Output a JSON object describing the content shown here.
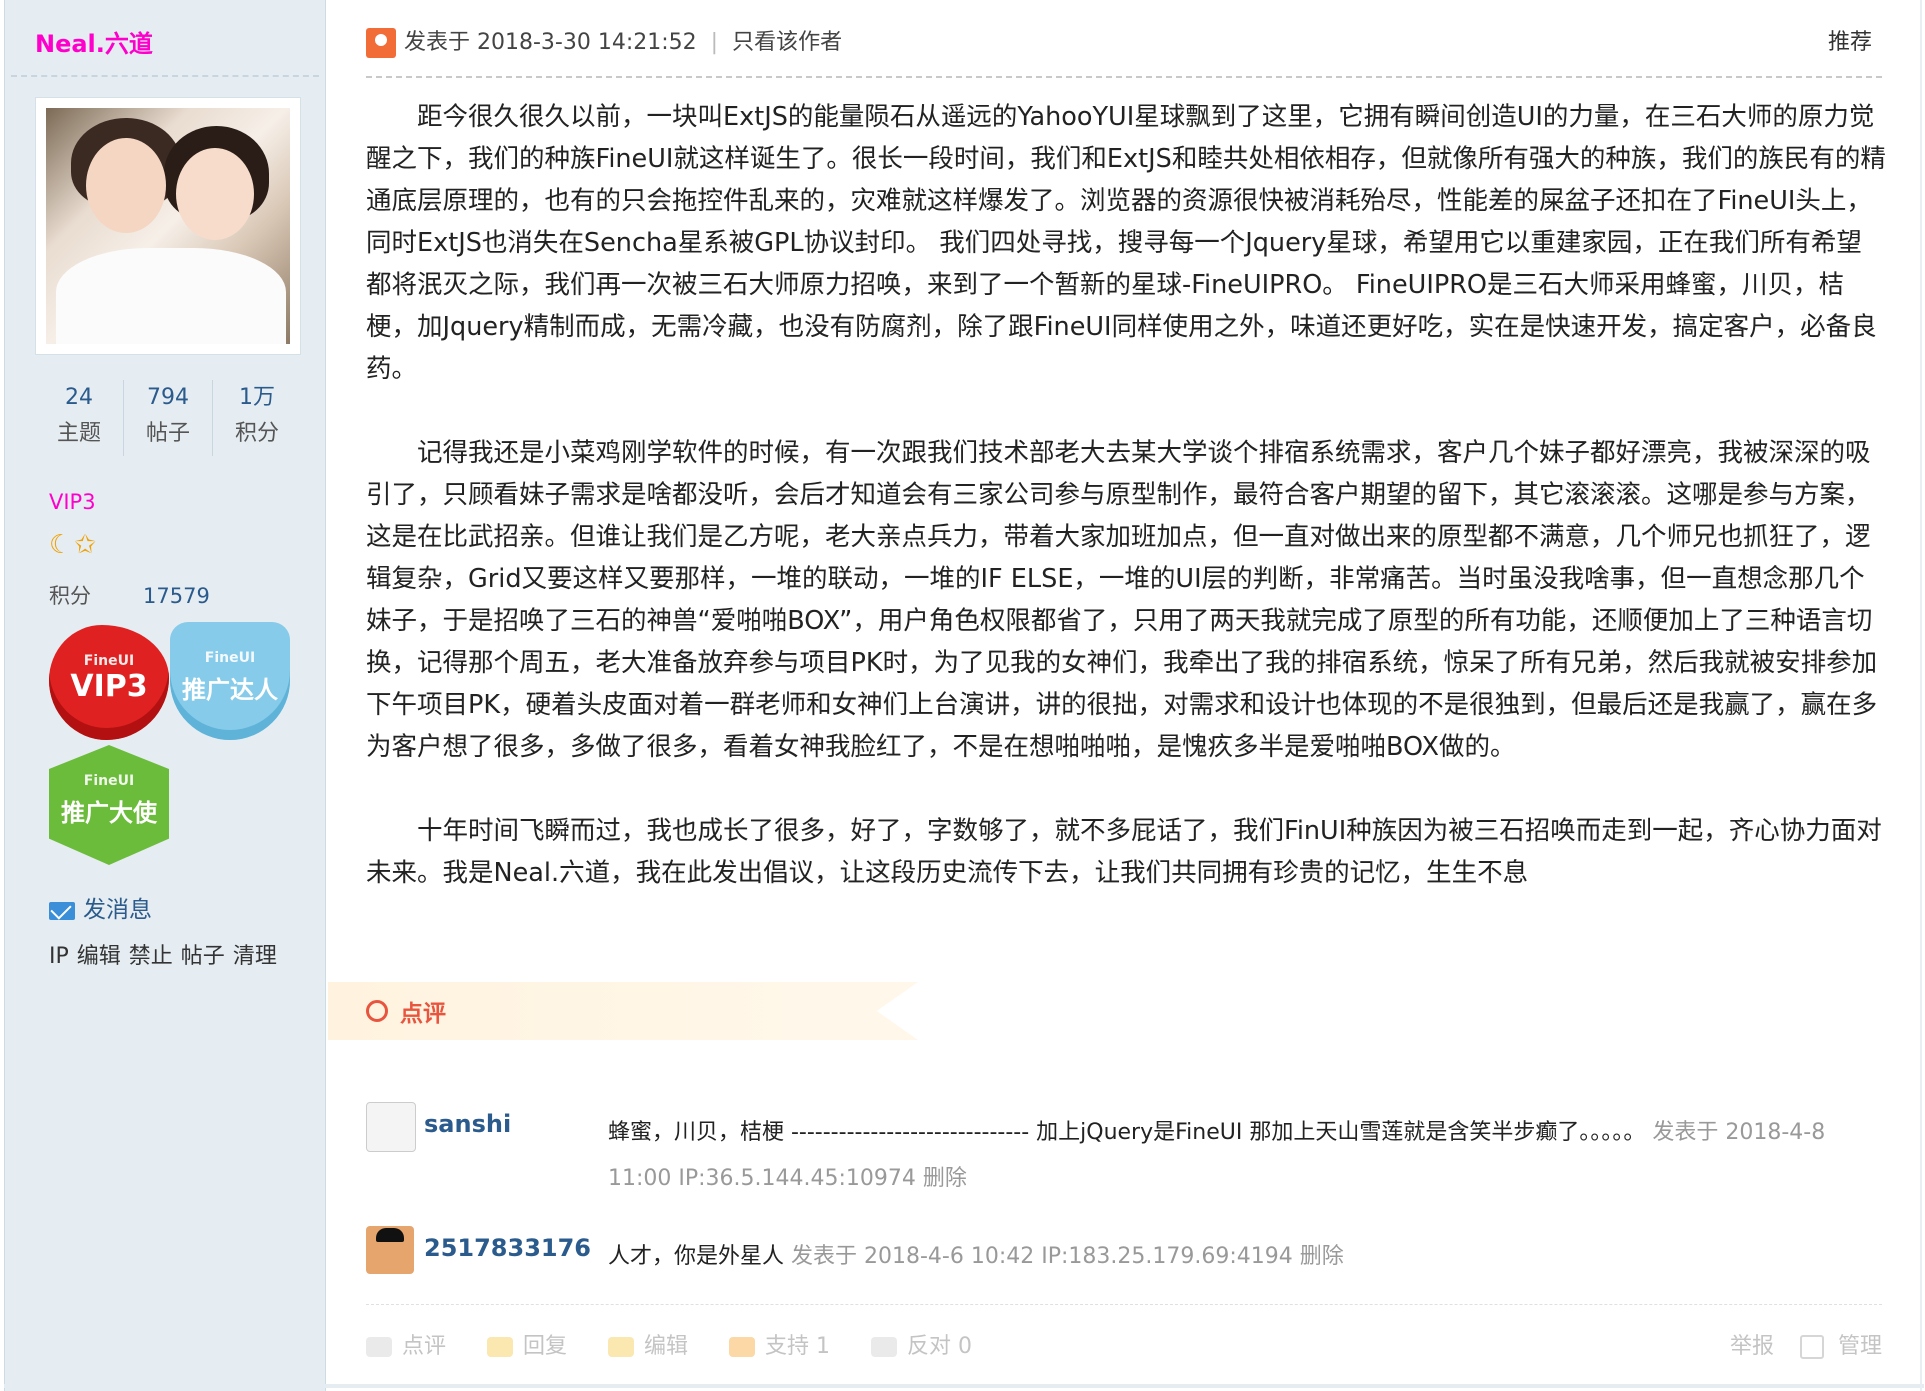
{
  "user": {
    "name": "Neal.六道",
    "stats": [
      {
        "value": "24",
        "label": "主题"
      },
      {
        "value": "794",
        "label": "帖子"
      },
      {
        "value": "1万",
        "label": "积分"
      }
    ],
    "vip": "VIP3",
    "stars": "☾✩",
    "score_label": "积分",
    "score_value": "17579",
    "badges": {
      "vip": {
        "top": "FineUI",
        "bottom": "VIP3"
      },
      "talent": {
        "top": "FineUI",
        "bottom": "推广达人"
      },
      "ambassador": {
        "top": "FineUI",
        "bottom": "推广大使"
      }
    },
    "message_label": "发消息",
    "admin_links": [
      "IP",
      "编辑",
      "禁止",
      "帖子",
      "清理"
    ]
  },
  "post": {
    "posted_at": "发表于 2018-3-30 14:21:52",
    "sep": "|",
    "only_author": "只看该作者",
    "recommend": "推荐",
    "paragraphs": [
      "距今很久很久以前，一块叫ExtJS的能量陨石从遥远的YahooYUI星球飘到了这里，它拥有瞬间创造UI的力量，在三石大师的原力觉醒之下，我们的种族FineUI就这样诞生了。很长一段时间，我们和ExtJS和睦共处相依相存，但就像所有强大的种族，我们的族民有的精通底层原理的，也有的只会拖控件乱来的，灾难就这样爆发了。浏览器的资源很快被消耗殆尽，性能差的屎盆子还扣在了FineUI头上，同时ExtJS也消失在Sencha星系被GPL协议封印。 我们四处寻找，搜寻每一个Jquery星球，希望用它以重建家园，正在我们所有希望都将泯灭之际，我们再一次被三石大师原力招唤，来到了一个暂新的星球-FineUIPRO。 FineUIPRO是三石大师采用蜂蜜，川贝，桔梗，加Jquery精制而成，无需冷藏，也没有防腐剂，除了跟FineUI同样使用之外，味道还更好吃，实在是快速开发，搞定客户，必备良药。",
      "记得我还是小菜鸡刚学软件的时候，有一次跟我们技术部老大去某大学谈个排宿系统需求，客户几个妹子都好漂亮，我被深深的吸引了，只顾看妹子需求是啥都没听，会后才知道会有三家公司参与原型制作，最符合客户期望的留下，其它滚滚滚。这哪是参与方案，这是在比武招亲。但谁让我们是乙方呢，老大亲点兵力，带着大家加班加点，但一直对做出来的原型都不满意，几个师兄也抓狂了，逻辑复杂，Grid又要这样又要那样，一堆的联动，一堆的IF ELSE，一堆的UI层的判断，非常痛苦。当时虽没我啥事，但一直想念那几个妹子，于是招唤了三石的神兽“爱啪啪BOX”，用户角色权限都省了，只用了两天我就完成了原型的所有功能，还顺便加上了三种语言切换，记得那个周五，老大准备放弃参与项目PK时，为了见我的女神们，我牵出了我的排宿系统，惊呆了所有兄弟，然后我就被安排参加下午项目PK，硬着头皮面对着一群老师和女神们上台演讲，讲的很拙，对需求和设计也体现的不是很独到，但最后还是我赢了，赢在多为客户想了很多，多做了很多，看着女神我脸红了，不是在想啪啪啪，是愧疚多半是爱啪啪BOX做的。",
      "十年时间飞瞬而过，我也成长了很多，好了，字数够了，就不多屁话了，我们FinUI种族因为被三石招唤而走到一起，齐心协力面对未来。我是Neal.六道，我在此发出倡议，让这段历史流传下去，让我们共同拥有珍贵的记忆，生生不息"
    ]
  },
  "review": {
    "tab_label": "点评",
    "comments": [
      {
        "user": "sanshi",
        "text": "蜂蜜，川贝，桔梗 ------------------------------ 加上jQuery是FineUI 那加上天山雪莲就是含笑半步癫了。。。。。",
        "meta": "发表于 2018-4-8 11:00 IP:36.5.144.45:10974 删除"
      },
      {
        "user": "2517833176",
        "text": "人才，你是外星人",
        "meta": "发表于 2018-4-6 10:42 IP:183.25.179.69:4194 删除"
      }
    ]
  },
  "footer": {
    "review": "点评",
    "reply": "回复",
    "edit": "编辑",
    "support": "支持 1",
    "oppose": "反对 0",
    "report": "举报",
    "manage": "管理"
  }
}
